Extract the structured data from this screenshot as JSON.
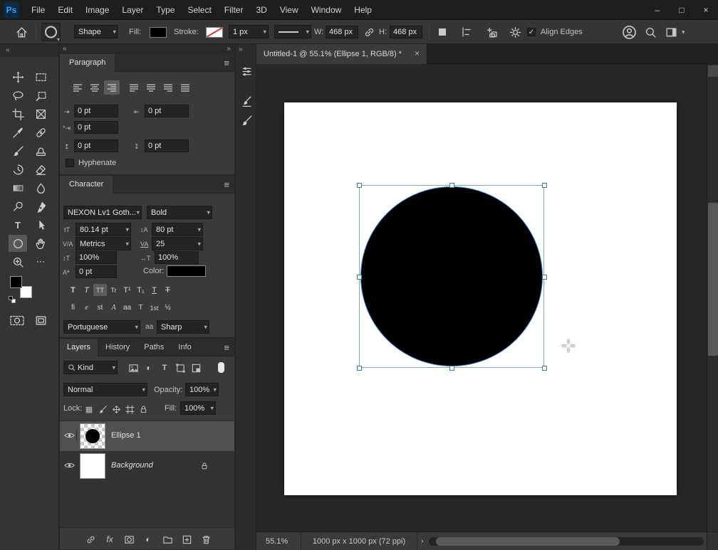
{
  "app": {
    "logo": "Ps"
  },
  "glyphs": {
    "chevron_down": "▾",
    "chevron_right": "›",
    "collapse_left": "«",
    "collapse_right": "»",
    "panel_menu": "≡",
    "close": "×",
    "check": "✓",
    "minimize": "–",
    "maximize": "□",
    "dots": "⋯",
    "adjustment": "◐",
    "checker": "▦",
    "type_t": "T",
    "fx": "fx"
  },
  "menu": {
    "items": [
      "File",
      "Edit",
      "Image",
      "Layer",
      "Type",
      "Select",
      "Filter",
      "3D",
      "View",
      "Window",
      "Help"
    ]
  },
  "options": {
    "preset": "Shape",
    "fill_label": "Fill:",
    "stroke_label": "Stroke:",
    "stroke_width": "1 px",
    "w_label": "W:",
    "w_value": "468 px",
    "h_label": "H:",
    "h_value": "468 px",
    "align_edges": "Align Edges"
  },
  "paragraph": {
    "tab": "Paragraph",
    "indent_left": "0 pt",
    "indent_right": "0 pt",
    "indent_first": "0 pt",
    "space_before": "0 pt",
    "space_after": "0 pt",
    "hyphenate": "Hyphenate"
  },
  "para_icons": {
    "indent_left": "⇥",
    "indent_right": "⇤",
    "indent_first": "*⇥",
    "space_before": "↥",
    "space_after": "↧"
  },
  "character": {
    "tab": "Character",
    "font_family": "NEXON Lv1 Goth...",
    "font_style": "Bold",
    "size": "80.14 pt",
    "leading": "80 pt",
    "kerning": "Metrics",
    "tracking": "25",
    "v_scale": "100%",
    "h_scale": "100%",
    "baseline": "0 pt",
    "color_label": "Color:",
    "styles": [
      "T",
      "T",
      "TT",
      "Tr",
      "T¹",
      "T₁",
      "T",
      "T"
    ],
    "opentype": [
      "fi",
      "e",
      "st",
      "A",
      "aa",
      "T",
      "1st",
      "½"
    ],
    "language": "Portuguese",
    "aa_label": "aa",
    "antialias": "Sharp"
  },
  "char_icons": {
    "size": "tT",
    "leading": "↕A",
    "kerning": "V/A",
    "tracking": "VA",
    "v_scale": "↕T",
    "h_scale": "↔T",
    "baseline": "Aª"
  },
  "layers": {
    "tabs": [
      "Layers",
      "History",
      "Paths",
      "Info"
    ],
    "kind": "Kind",
    "blend_mode": "Normal",
    "opacity_label": "Opacity:",
    "opacity": "100%",
    "lock_label": "Lock:",
    "fill_label": "Fill:",
    "fill": "100%",
    "rows": [
      {
        "name": "Ellipse 1"
      },
      {
        "name": "Background"
      }
    ]
  },
  "doc": {
    "tab_title": "Untitled-1 @ 55.1% (Ellipse 1, RGB/8) *",
    "zoom": "55.1%",
    "size_info": "1000 px x 1000 px (72 ppi)"
  }
}
